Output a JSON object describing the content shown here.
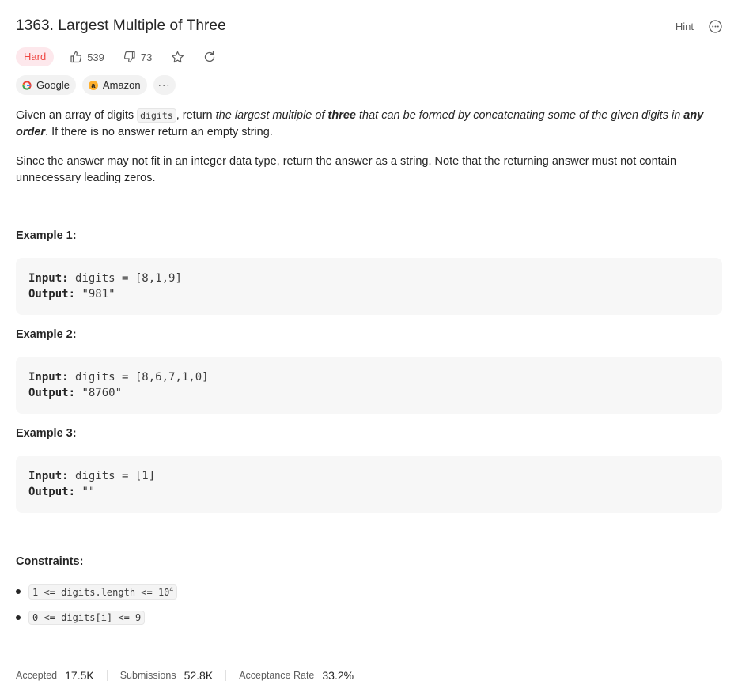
{
  "problem": {
    "title": "1363. Largest Multiple of Three",
    "hint_label": "Hint",
    "difficulty": "Hard",
    "likes": "539",
    "dislikes": "73"
  },
  "tags": [
    {
      "label": "Google",
      "icon": "google-icon"
    },
    {
      "label": "Amazon",
      "icon": "amazon-icon"
    },
    {
      "label": "···",
      "icon": "more-icon"
    }
  ],
  "description": {
    "p1_a": "Given an array of digits ",
    "p1_code": "digits",
    "p1_b": ", return ",
    "p1_em1": "the largest multiple of ",
    "p1_strong1": "three",
    "p1_em2": " that can be formed by concatenating some of the given digits in ",
    "p1_strong2": "any order",
    "p1_c": ". If there is no answer return an empty string.",
    "p2": "Since the answer may not fit in an integer data type, return the answer as a string. Note that the returning answer must not contain unnecessary leading zeros."
  },
  "examples": [
    {
      "title": "Example 1:",
      "input_label": "Input:",
      "input": "digits = [8,1,9]",
      "output_label": "Output:",
      "output": "\"981\""
    },
    {
      "title": "Example 2:",
      "input_label": "Input:",
      "input": "digits = [8,6,7,1,0]",
      "output_label": "Output:",
      "output": "\"8760\""
    },
    {
      "title": "Example 3:",
      "input_label": "Input:",
      "input": "digits = [1]",
      "output_label": "Output:",
      "output": "\"\""
    }
  ],
  "constraints": {
    "title": "Constraints:",
    "c1": "1 <= digits.length <= 10",
    "c1_sup": "4",
    "c2": "0 <= digits[i] <= 9"
  },
  "stats": {
    "accepted_label": "Accepted",
    "accepted": "17.5K",
    "submissions_label": "Submissions",
    "submissions": "52.8K",
    "rate_label": "Acceptance Rate",
    "rate": "33.2%"
  },
  "colors": {
    "hard": "#ef4743",
    "hard_bg": "#fde8ec"
  }
}
